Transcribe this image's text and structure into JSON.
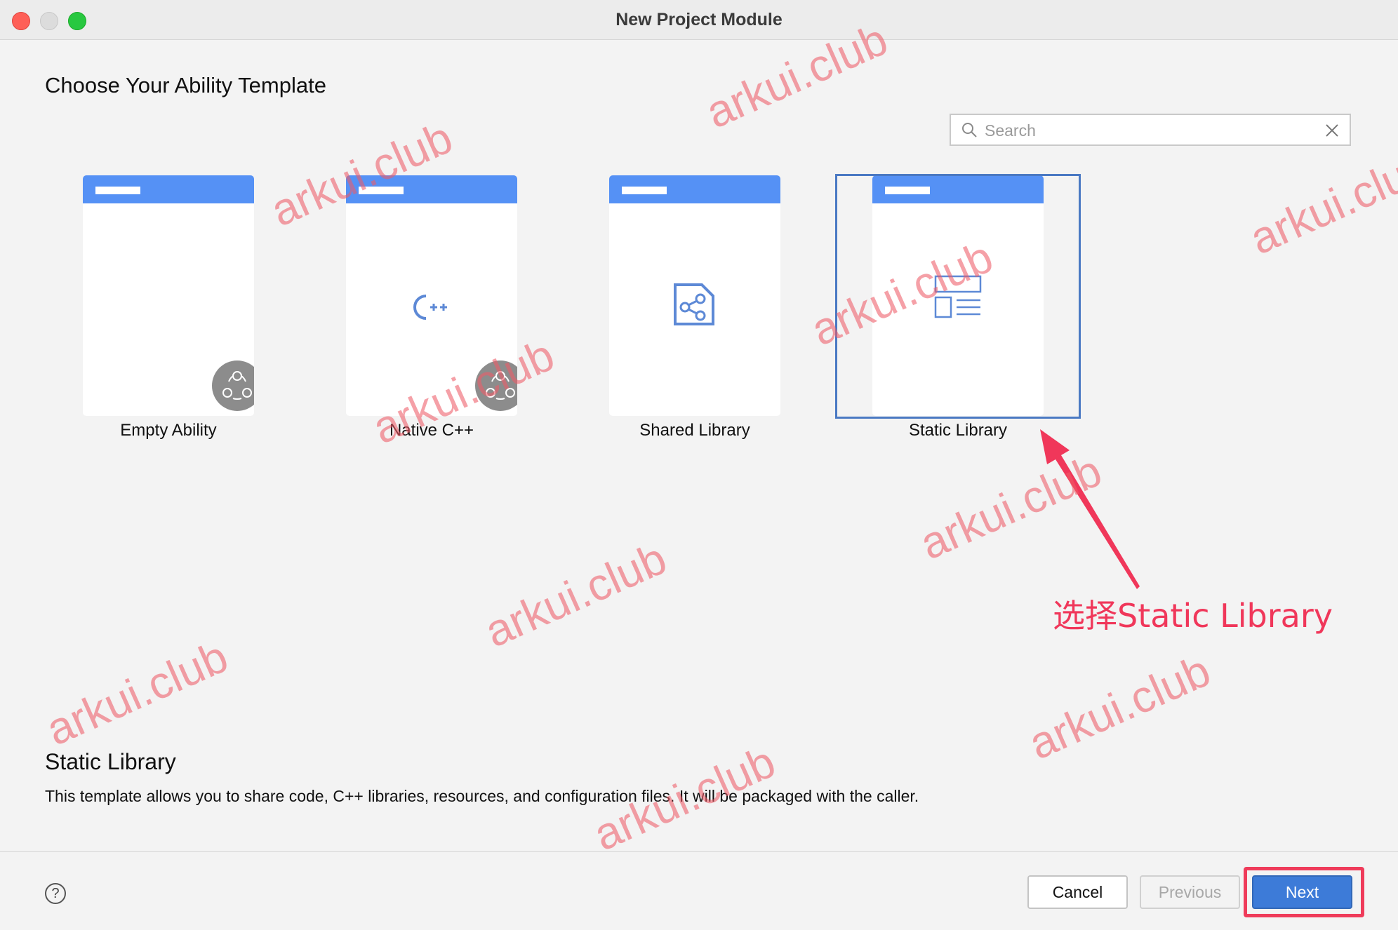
{
  "window": {
    "title": "New Project Module"
  },
  "heading": "Choose Your Ability Template",
  "search": {
    "placeholder": "Search",
    "value": ""
  },
  "templates": [
    {
      "label": "Empty Ability",
      "icon": "ability-badge-icon",
      "selected": false
    },
    {
      "label": "Native C++",
      "icon": "cpp-icon",
      "selected": false
    },
    {
      "label": "Shared Library",
      "icon": "shared-library-icon",
      "selected": false
    },
    {
      "label": "Static Library",
      "icon": "static-library-icon",
      "selected": true
    }
  ],
  "cpp_glyph": "C++",
  "description": {
    "title": "Static Library",
    "text": "This template allows you to share code, C++ libraries, resources, and configuration files. It will be packaged with the caller."
  },
  "footer": {
    "help": "?",
    "cancel": "Cancel",
    "previous": "Previous",
    "next": "Next"
  },
  "annotation": {
    "text": "选择Static Library"
  },
  "watermark": "arkui.club",
  "colors": {
    "accent": "#5591f5",
    "selection": "#4a79c3",
    "next_button": "#3d7bd8",
    "annotation": "#f0375a"
  }
}
